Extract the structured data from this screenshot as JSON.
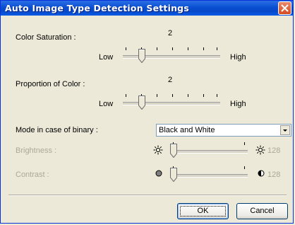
{
  "window": {
    "title": "Auto Image Type Detection Settings"
  },
  "color_saturation": {
    "label": "Color Saturation :",
    "value": "2",
    "low_label": "Low",
    "high_label": "High",
    "level": 0.167
  },
  "proportion_of_color": {
    "label": "Proportion of Color :",
    "value": "2",
    "low_label": "Low",
    "high_label": "High",
    "level": 0.167
  },
  "binary_mode": {
    "label": "Mode in case of binary :",
    "selected": "Black and White"
  },
  "brightness": {
    "label": "Brightness :",
    "value": "128",
    "level": 0.0,
    "enabled": false,
    "icon": "sun-icon"
  },
  "contrast": {
    "label": "Contrast :",
    "value": "128",
    "level": 0.0,
    "enabled": false,
    "icon": "contrast-icon"
  },
  "buttons": {
    "ok": "OK",
    "cancel": "Cancel"
  },
  "colors": {
    "title_bar": "#0a4fd1",
    "dialog_bg": "#ece9d8",
    "disabled_text": "#aca899"
  }
}
